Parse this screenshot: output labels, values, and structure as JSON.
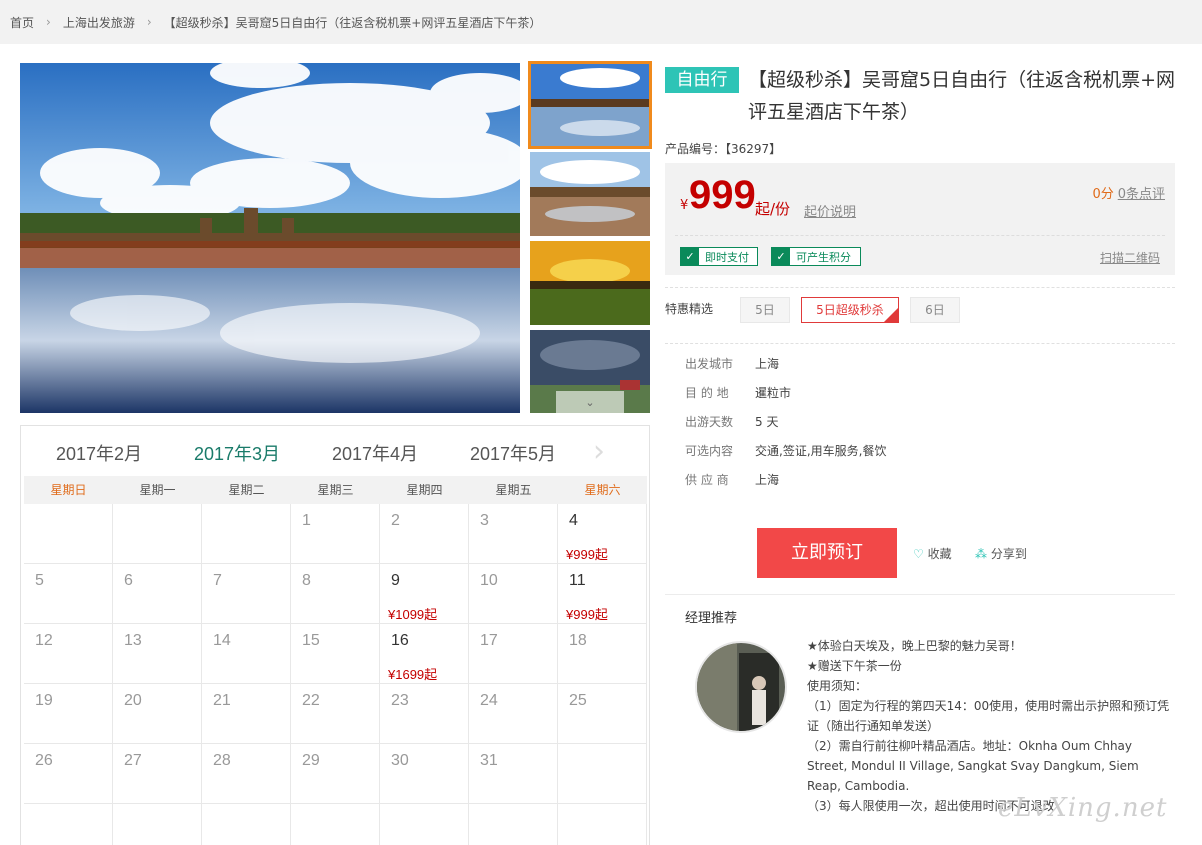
{
  "breadcrumb": {
    "items": [
      "首页",
      "上海出发旅游",
      "【超级秒杀】吴哥窟5日自由行（往返含税机票+网评五星酒店下午茶）"
    ]
  },
  "product": {
    "tag": "自由行",
    "title": "【超级秒杀】吴哥窟5日自由行（往返含税机票+网评五星酒店下午茶）",
    "product_no": "产品编号：【36297】"
  },
  "price_box": {
    "currency": "¥",
    "price": "999",
    "unit": "起/份",
    "explain_link": "起价说明",
    "score": "0分",
    "reviews": "0条点评",
    "badges": [
      "即时支付",
      "可产生积分"
    ],
    "qr_link": "扫描二维码"
  },
  "options": {
    "label": "特惠精选",
    "items": [
      "5日",
      "5日超级秒杀",
      "6日"
    ],
    "selected": "5日超级秒杀"
  },
  "info": [
    {
      "k": "出发城市",
      "v": "上海"
    },
    {
      "k": "目 的 地",
      "v": "暹粒市"
    },
    {
      "k": "出游天数",
      "v": "5 天"
    },
    {
      "k": "可选内容",
      "v": "交通,签证,用车服务,餐饮"
    },
    {
      "k": "供 应 商",
      "v": "上海"
    }
  ],
  "actions": {
    "book": "立即预订",
    "favorite": "收藏",
    "share": "分享到"
  },
  "manager": {
    "title": "经理推荐",
    "lines": [
      "★体验白天埃及，晚上巴黎的魅力吴哥！",
      "★赠送下午茶一份",
      "使用须知：",
      "（1）固定为行程的第四天14：00使用，使用时需出示护照和预订凭证（随出行通知单发送）",
      "（2）需自行前往柳叶精品酒店。地址：Oknha Oum Chhay Street, Mondul II Village, Sangkat Svay Dangkum, Siem Reap, Cambodia.",
      "（3）每人限使用一次，超出使用时间不可退改"
    ]
  },
  "calendar": {
    "months": [
      "2017年2月",
      "2017年3月",
      "2017年4月",
      "2017年5月"
    ],
    "active_month": "2017年3月",
    "weekdays": [
      "星期日",
      "星期一",
      "星期二",
      "星期三",
      "星期四",
      "星期五",
      "星期六"
    ],
    "weeks": [
      [
        {
          "d": ""
        },
        {
          "d": ""
        },
        {
          "d": ""
        },
        {
          "d": "1"
        },
        {
          "d": "2"
        },
        {
          "d": "3"
        },
        {
          "d": "4",
          "p": "¥999起"
        }
      ],
      [
        {
          "d": "5"
        },
        {
          "d": "6"
        },
        {
          "d": "7"
        },
        {
          "d": "8"
        },
        {
          "d": "9",
          "p": "¥1099起"
        },
        {
          "d": "10"
        },
        {
          "d": "11",
          "p": "¥999起"
        }
      ],
      [
        {
          "d": "12"
        },
        {
          "d": "13"
        },
        {
          "d": "14"
        },
        {
          "d": "15"
        },
        {
          "d": "16",
          "p": "¥1699起"
        },
        {
          "d": "17"
        },
        {
          "d": "18"
        }
      ],
      [
        {
          "d": "19"
        },
        {
          "d": "20"
        },
        {
          "d": "21"
        },
        {
          "d": "22"
        },
        {
          "d": "23"
        },
        {
          "d": "24"
        },
        {
          "d": "25"
        }
      ],
      [
        {
          "d": "26"
        },
        {
          "d": "27"
        },
        {
          "d": "28"
        },
        {
          "d": "29"
        },
        {
          "d": "30"
        },
        {
          "d": "31"
        },
        {
          "d": ""
        }
      ],
      [
        {
          "d": ""
        },
        {
          "d": ""
        },
        {
          "d": ""
        },
        {
          "d": ""
        },
        {
          "d": ""
        },
        {
          "d": ""
        },
        {
          "d": ""
        }
      ]
    ]
  },
  "watermark": "eLvXing.net",
  "colors": {
    "accent": "#2ec4b6",
    "price": "#c40000",
    "book": "#f24848",
    "active_month": "#1a7b6a"
  }
}
